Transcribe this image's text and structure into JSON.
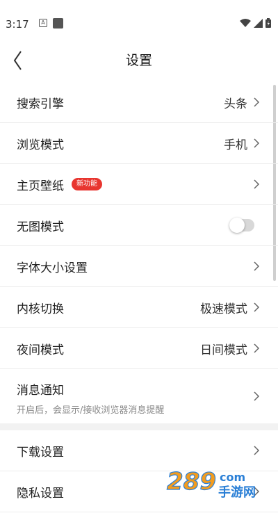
{
  "status_bar": {
    "time": "3:17",
    "notification_icons": [
      "a-box-icon",
      "square-icon"
    ],
    "signal_icons": [
      "wifi-icon",
      "signal-icon",
      "battery-icon"
    ]
  },
  "header": {
    "title": "设置",
    "back_icon": "chevron-left-icon"
  },
  "settings": {
    "search_engine": {
      "label": "搜索引擎",
      "value": "头条"
    },
    "browse_mode": {
      "label": "浏览模式",
      "value": "手机"
    },
    "wallpaper": {
      "label": "主页壁纸",
      "badge": "新功能"
    },
    "no_image_mode": {
      "label": "无图模式",
      "enabled": false
    },
    "font_size": {
      "label": "字体大小设置"
    },
    "kernel_switch": {
      "label": "内核切换",
      "value": "极速模式"
    },
    "night_mode": {
      "label": "夜间模式",
      "value": "日间模式"
    },
    "notifications": {
      "label": "消息通知",
      "description": "开启后，会显示/接收浏览器消息提醒"
    },
    "download_settings": {
      "label": "下载设置"
    },
    "privacy_settings": {
      "label": "隐私设置"
    }
  },
  "watermark": {
    "digits": "289",
    "domain": "com",
    "text": "手游网"
  },
  "colors": {
    "badge": "#e8352f",
    "divider": "#ececec",
    "section_gap": "#f2f2f2",
    "watermark_blue": "#2a7fd6",
    "watermark_orange": "#f39c1f"
  }
}
